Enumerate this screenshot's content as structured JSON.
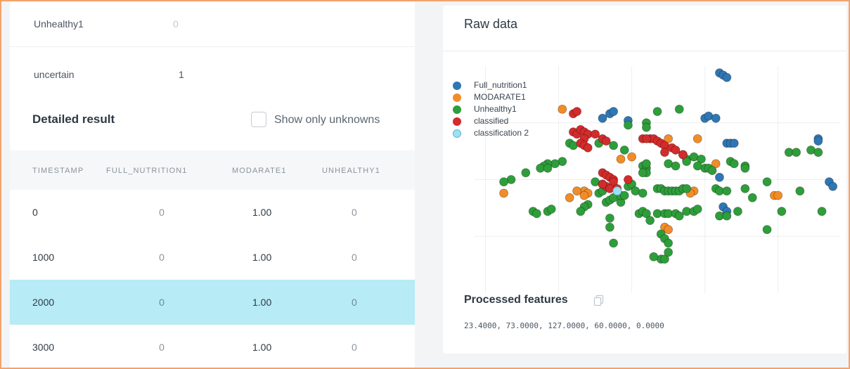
{
  "summary": [
    {
      "label": "Unhealthy1",
      "value": "0"
    },
    {
      "label": "uncertain",
      "value": "1"
    }
  ],
  "detailed": {
    "title": "Detailed result",
    "checkbox_label": "Show only unknowns",
    "checkbox_checked": false,
    "columns": [
      "TIMESTAMP",
      "FULL_NUTRITION1",
      "MODARATE1",
      "UNHEALTHY1"
    ],
    "rows": [
      {
        "timestamp": "0",
        "full_nutrition1": "0",
        "modarate1": "1.00",
        "unhealthy1": "0"
      },
      {
        "timestamp": "1000",
        "full_nutrition1": "0",
        "modarate1": "1.00",
        "unhealthy1": "0"
      },
      {
        "timestamp": "2000",
        "full_nutrition1": "0",
        "modarate1": "1.00",
        "unhealthy1": "0"
      },
      {
        "timestamp": "3000",
        "full_nutrition1": "0",
        "modarate1": "1.00",
        "unhealthy1": "0"
      }
    ],
    "selected_row": 2
  },
  "raw_data": {
    "title": "Raw data",
    "processed_features_title": "Processed features",
    "processed_features_values": "23.4000, 73.0000, 127.0000, 60.0000, 0.0000",
    "copy_icon": "copy-icon"
  },
  "colors": {
    "full_nutrition1": "#2f77b4",
    "modarate1": "#f28c28",
    "unhealthy1": "#2e9e3a",
    "classified": "#d42b2b",
    "classification2": "#9ee0f2",
    "selected_row": "#b7ebf6",
    "frame_border": "#f3a36a"
  },
  "chart_data": {
    "type": "scatter",
    "xlabel": "",
    "ylabel": "",
    "xlim": [
      0,
      100
    ],
    "ylim": [
      0,
      100
    ],
    "grid": true,
    "legend_position": "top-left",
    "series": [
      {
        "name": "Full_nutrition1",
        "color": "#2f77b4",
        "points": [
          [
            67,
            97
          ],
          [
            68,
            96
          ],
          [
            69,
            95
          ],
          [
            35,
            77
          ],
          [
            37,
            79
          ],
          [
            38,
            80
          ],
          [
            42,
            76
          ],
          [
            63,
            77
          ],
          [
            64,
            78
          ],
          [
            66,
            77
          ],
          [
            69,
            66
          ],
          [
            70,
            66
          ],
          [
            71,
            66
          ],
          [
            67,
            51
          ],
          [
            94,
            68
          ],
          [
            94,
            67
          ],
          [
            97,
            49
          ],
          [
            98,
            47
          ],
          [
            68,
            38
          ],
          [
            69,
            36
          ]
        ]
      },
      {
        "name": "MODARATE1",
        "color": "#f28c28",
        "points": [
          [
            24,
            81
          ],
          [
            53,
            68
          ],
          [
            61,
            68
          ],
          [
            30,
            45
          ],
          [
            31,
            44
          ],
          [
            40,
            59
          ],
          [
            30,
            43
          ],
          [
            43,
            60
          ],
          [
            57,
            61
          ],
          [
            66,
            57
          ],
          [
            60,
            45
          ],
          [
            59,
            44
          ],
          [
            82,
            43
          ],
          [
            83,
            43
          ],
          [
            8,
            44
          ],
          [
            28,
            45
          ],
          [
            52,
            29
          ],
          [
            53,
            28
          ],
          [
            26,
            42
          ]
        ]
      },
      {
        "name": "Unhealthy1",
        "color": "#2e9e3a",
        "points": [
          [
            47,
            75
          ],
          [
            50,
            80
          ],
          [
            56,
            81
          ],
          [
            47,
            73
          ],
          [
            42,
            74
          ],
          [
            34,
            66
          ],
          [
            26,
            66
          ],
          [
            27,
            65
          ],
          [
            38,
            65
          ],
          [
            41,
            63
          ],
          [
            58,
            59
          ],
          [
            60,
            60
          ],
          [
            62,
            59
          ],
          [
            58,
            58
          ],
          [
            63,
            55
          ],
          [
            64,
            55
          ],
          [
            65,
            54
          ],
          [
            70,
            58
          ],
          [
            71,
            57
          ],
          [
            74,
            56
          ],
          [
            74,
            55
          ],
          [
            24,
            58
          ],
          [
            22,
            57
          ],
          [
            20,
            57
          ],
          [
            19,
            56
          ],
          [
            18,
            55
          ],
          [
            14,
            53
          ],
          [
            10,
            50
          ],
          [
            8,
            49
          ],
          [
            46,
            56
          ],
          [
            47,
            55
          ],
          [
            47,
            53
          ],
          [
            47,
            57
          ],
          [
            53,
            57
          ],
          [
            55,
            56
          ],
          [
            61,
            56
          ],
          [
            66,
            46
          ],
          [
            67,
            45
          ],
          [
            69,
            45
          ],
          [
            74,
            46
          ],
          [
            50,
            46
          ],
          [
            51,
            46
          ],
          [
            52,
            45
          ],
          [
            53,
            45
          ],
          [
            54,
            45
          ],
          [
            55,
            45
          ],
          [
            56,
            45
          ],
          [
            57,
            46
          ],
          [
            58,
            46
          ],
          [
            34,
            44
          ],
          [
            35,
            45
          ],
          [
            42,
            47
          ],
          [
            43,
            48
          ],
          [
            46,
            53
          ],
          [
            33,
            49
          ],
          [
            35,
            48
          ],
          [
            44,
            45
          ],
          [
            46,
            44
          ],
          [
            36,
            40
          ],
          [
            37,
            41
          ],
          [
            38,
            42
          ],
          [
            40,
            40
          ],
          [
            31,
            39
          ],
          [
            30,
            38
          ],
          [
            16,
            36
          ],
          [
            17,
            35
          ],
          [
            20,
            36
          ],
          [
            21,
            37
          ],
          [
            29,
            36
          ],
          [
            45,
            35
          ],
          [
            46,
            36
          ],
          [
            47,
            35
          ],
          [
            50,
            35
          ],
          [
            52,
            35
          ],
          [
            53,
            35
          ],
          [
            55,
            35
          ],
          [
            56,
            34
          ],
          [
            58,
            36
          ],
          [
            60,
            36
          ],
          [
            61,
            37
          ],
          [
            67,
            34
          ],
          [
            69,
            34
          ],
          [
            72,
            36
          ],
          [
            84,
            36
          ],
          [
            89,
            45
          ],
          [
            95,
            36
          ],
          [
            86,
            62
          ],
          [
            88,
            62
          ],
          [
            92,
            63
          ],
          [
            94,
            62
          ],
          [
            40,
            43
          ],
          [
            41,
            43
          ],
          [
            51,
            26
          ],
          [
            52,
            24
          ],
          [
            53,
            22
          ],
          [
            37,
            29
          ],
          [
            37,
            33
          ],
          [
            48,
            32
          ],
          [
            38,
            22
          ],
          [
            51,
            15
          ],
          [
            52,
            15
          ],
          [
            49,
            16
          ],
          [
            53,
            18
          ],
          [
            80,
            28
          ],
          [
            76,
            42
          ],
          [
            80,
            49
          ],
          [
            20,
            55
          ]
        ]
      },
      {
        "name": "classified",
        "color": "#d42b2b",
        "points": [
          [
            27,
            79
          ],
          [
            28,
            80
          ],
          [
            27,
            71
          ],
          [
            28,
            70
          ],
          [
            29,
            72
          ],
          [
            30,
            71
          ],
          [
            31,
            70
          ],
          [
            30,
            68
          ],
          [
            33,
            70
          ],
          [
            35,
            68
          ],
          [
            29,
            66
          ],
          [
            30,
            65
          ],
          [
            31,
            64
          ],
          [
            36,
            67
          ],
          [
            48,
            68
          ],
          [
            49,
            68
          ],
          [
            50,
            67
          ],
          [
            51,
            66
          ],
          [
            52,
            65
          ],
          [
            54,
            64
          ],
          [
            52,
            62
          ],
          [
            55,
            63
          ],
          [
            57,
            61
          ],
          [
            46,
            68
          ],
          [
            47,
            68
          ],
          [
            35,
            53
          ],
          [
            36,
            52
          ],
          [
            37,
            51
          ],
          [
            38,
            50
          ],
          [
            38,
            49
          ],
          [
            36,
            47
          ],
          [
            35,
            48
          ],
          [
            37,
            46
          ],
          [
            39,
            46
          ],
          [
            42,
            50
          ]
        ]
      },
      {
        "name": "classification 2",
        "color": "#9ee0f2",
        "points": [
          [
            39,
            45
          ]
        ]
      }
    ]
  }
}
